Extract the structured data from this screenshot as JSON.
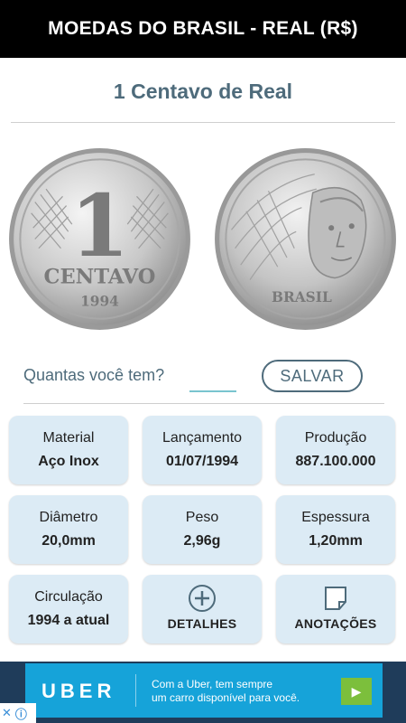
{
  "app": {
    "title": "MOEDAS DO BRASIL - REAL (R$)"
  },
  "coin": {
    "name": "1 Centavo de Real",
    "front": {
      "value_text": "1",
      "unit_text": "CENTAVO",
      "year_text": "1994"
    },
    "back": {
      "country_text": "BRASIL"
    }
  },
  "quantity": {
    "label": "Quantas você tem?",
    "value": "",
    "save_label": "SALVAR"
  },
  "details": {
    "material": {
      "label": "Material",
      "value": "Aço Inox"
    },
    "release": {
      "label": "Lançamento",
      "value": "01/07/1994"
    },
    "production": {
      "label": "Produção",
      "value": "887.100.000"
    },
    "diameter": {
      "label": "Diâmetro",
      "value": "20,0mm"
    },
    "weight": {
      "label": "Peso",
      "value": "2,96g"
    },
    "thickness": {
      "label": "Espessura",
      "value": "1,20mm"
    },
    "circulation": {
      "label": "Circulação",
      "value": "1994 a atual"
    }
  },
  "actions": {
    "details": {
      "label": "DETALHES",
      "icon": "plus-circle-icon"
    },
    "notes": {
      "label": "ANOTAÇÕES",
      "icon": "note-icon"
    }
  },
  "ad": {
    "brand": "UBER",
    "line1": "Com a Uber, tem sempre",
    "line2": "um carro disponível para você.",
    "arrow_icon": "play-arrow-icon",
    "close_icon": "close-icon",
    "info_icon": "info-icon"
  },
  "colors": {
    "accent": "#4e6b7b",
    "card_bg": "#dcebf5",
    "appbar": "#000000",
    "input_underline": "#79c4cf"
  }
}
